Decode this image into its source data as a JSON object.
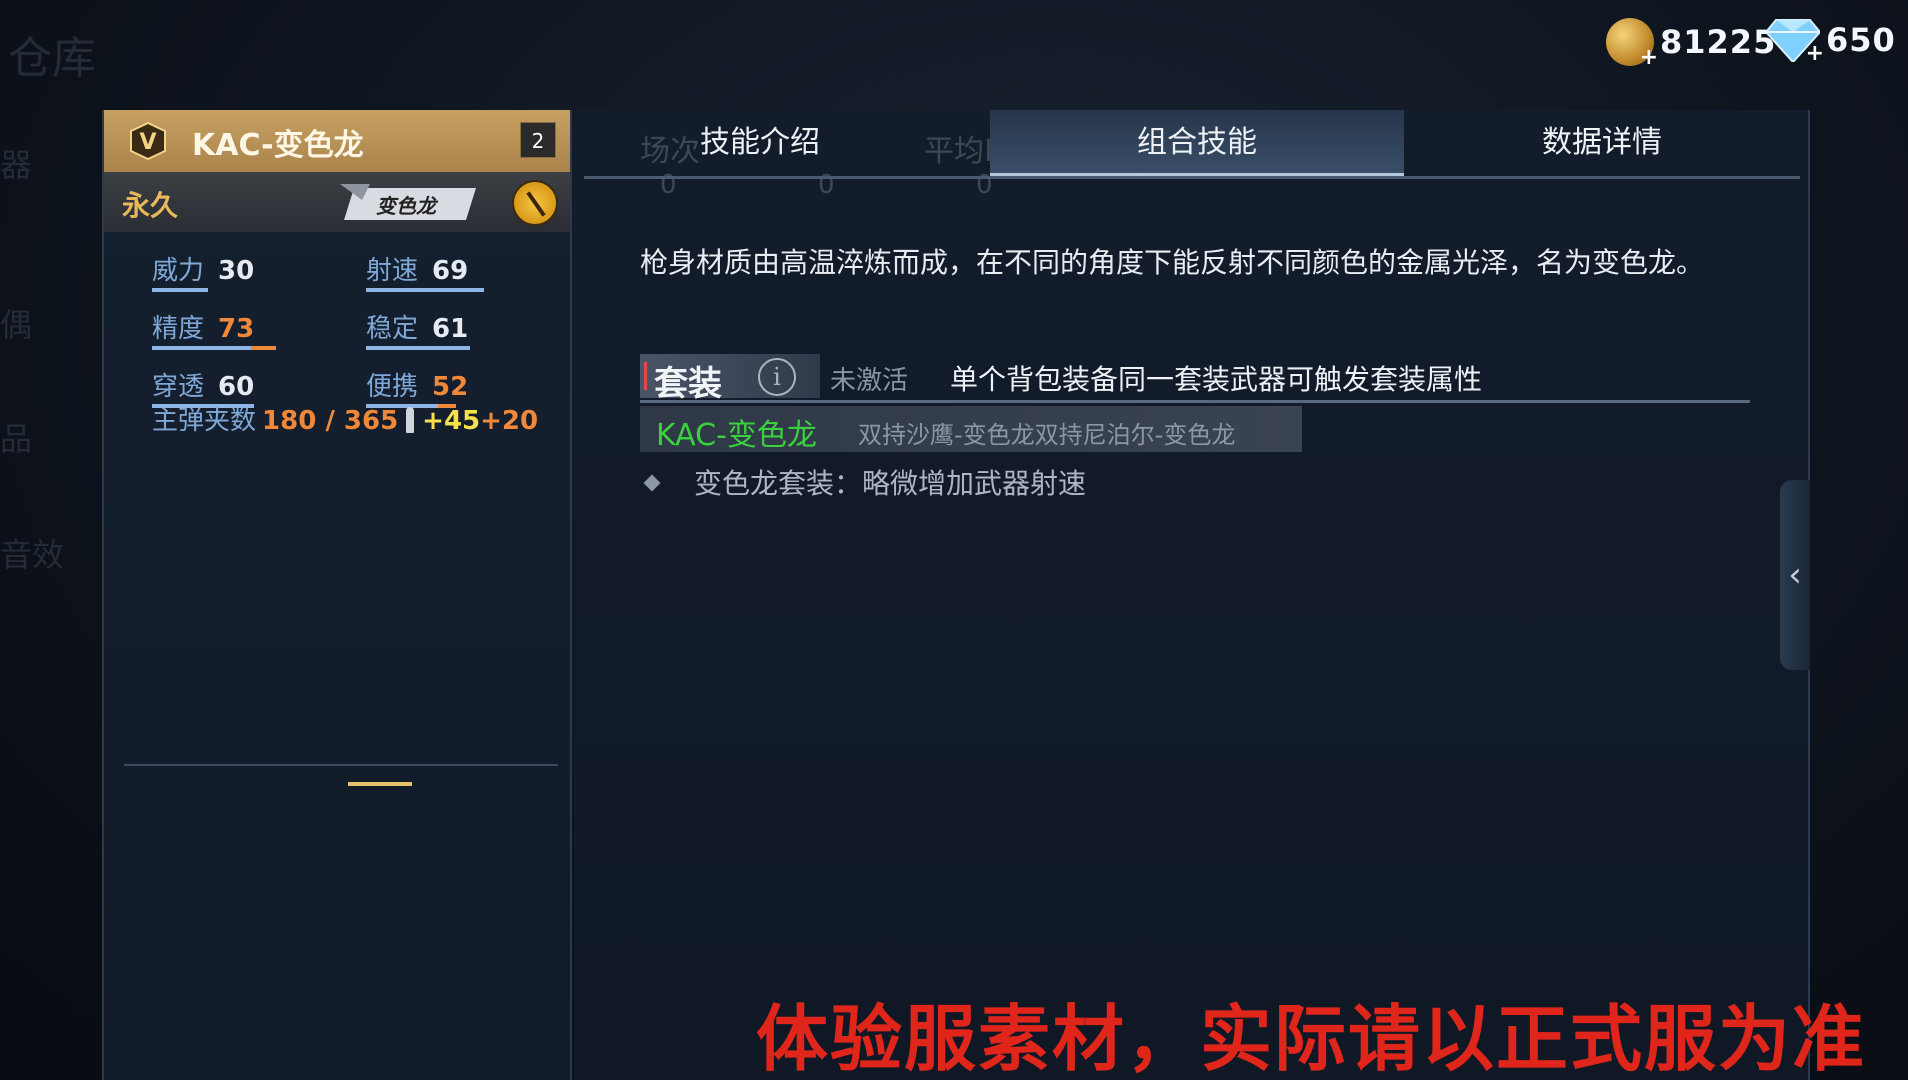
{
  "background": {
    "title": "仓库",
    "side_labels": [
      "器",
      "偶",
      "品",
      "音效"
    ]
  },
  "currency": {
    "gold": "81225",
    "diamond": "650"
  },
  "weapon": {
    "name": "KAC-变色龙",
    "level": "2",
    "duration": "永久",
    "skin_label": "变色龙",
    "stats": [
      {
        "label": "威力",
        "value": "30",
        "fill": 0.3,
        "highlight": false
      },
      {
        "label": "射速",
        "value": "69",
        "fill": 0.69,
        "highlight": false
      },
      {
        "label": "精度",
        "value": "73",
        "fill": 0.73,
        "highlight": true
      },
      {
        "label": "稳定",
        "value": "61",
        "fill": 0.61,
        "highlight": false
      },
      {
        "label": "穿透",
        "value": "60",
        "fill": 0.6,
        "highlight": false
      },
      {
        "label": "便携",
        "value": "52",
        "fill": 0.52,
        "highlight": true
      }
    ],
    "ammo": {
      "label": "主弹夹数",
      "value": "180 / 365",
      "bonus1": "+45",
      "bonus2": "+20"
    }
  },
  "tabs": [
    {
      "label": "技能介绍",
      "active": false
    },
    {
      "label": "组合技能",
      "active": true
    },
    {
      "label": "数据详情",
      "active": false
    }
  ],
  "ghost_header": {
    "c1": "场次",
    "c2": "平均KDA",
    "zeros": [
      "0",
      "0",
      "0"
    ]
  },
  "description": "枪身材质由高温淬炼而成，在不同的角度下能反射不同颜色的金属光泽，名为变色龙。",
  "suit": {
    "tag": "套装",
    "status": "未激活",
    "desc": "单个背包装备同一套装武器可触发套装属性",
    "item_primary": "KAC-变色龙",
    "item_others": "双持沙鹰-变色龙双持尼泊尔-变色龙",
    "bonus": "变色龙套装：略微增加武器射速"
  },
  "watermark": "体验服素材，实际请以正式服为准",
  "colors": {
    "accent_orange": "#f0883a",
    "accent_green": "#39d13c",
    "watermark_red": "#e0261a",
    "gold_header": "#c7a162"
  }
}
